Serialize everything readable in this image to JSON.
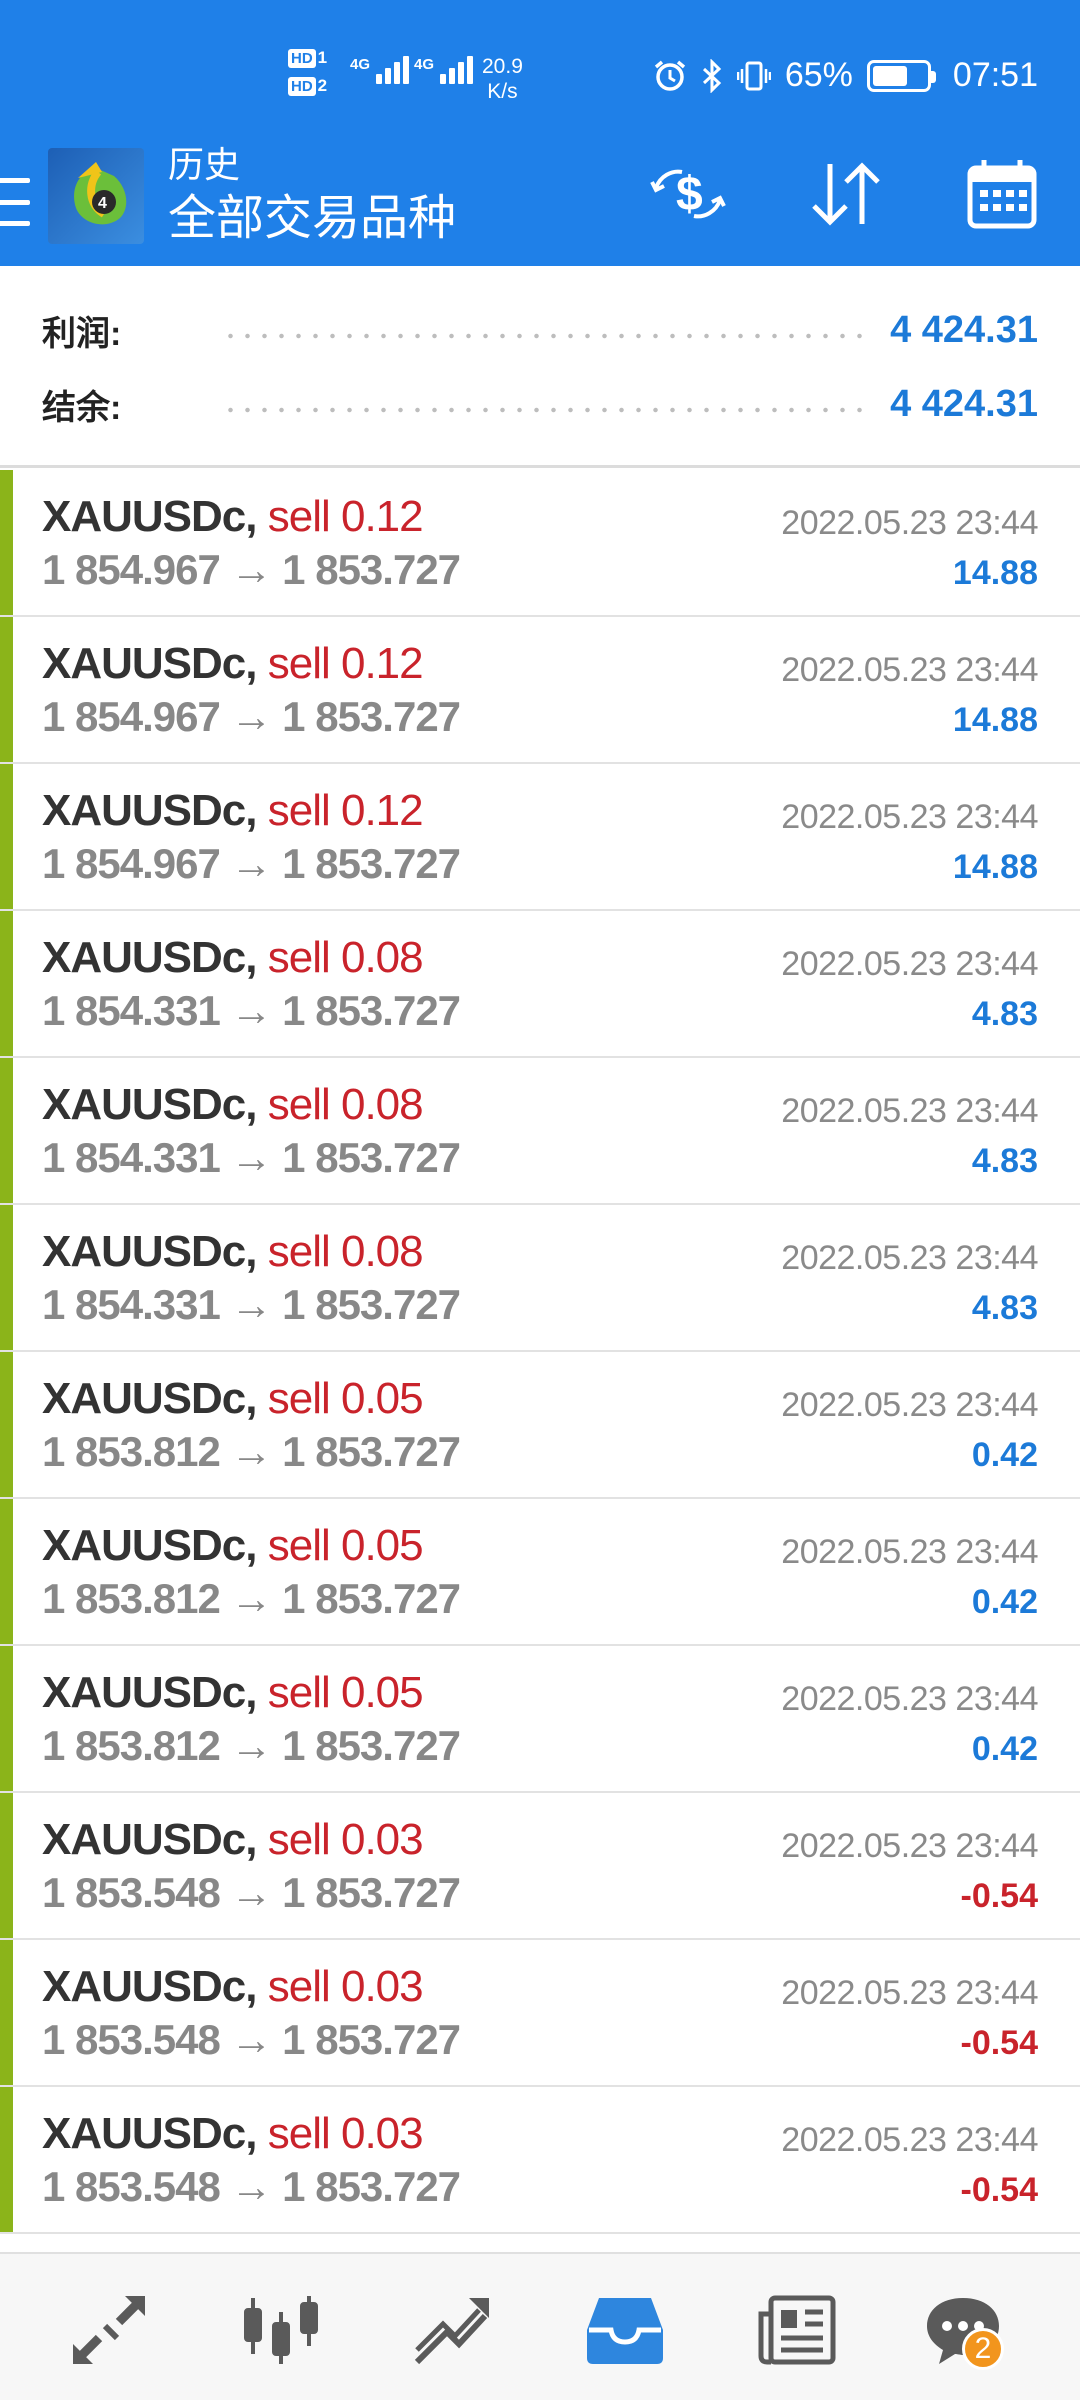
{
  "status_bar": {
    "hd1": "HD",
    "hd1_num": "1",
    "hd2": "HD",
    "hd2_num": "2",
    "sig1_label": "4G",
    "sig2_label": "4G",
    "speed_value": "20.9",
    "speed_unit": "K/s",
    "battery_percent": "65%",
    "battery_level": 0.65,
    "time": "07:51"
  },
  "toolbar": {
    "title_small": "历史",
    "title_big": "全部交易品种"
  },
  "summary": {
    "profit_label": "利润:",
    "profit_value": "4 424.31",
    "balance_label": "结余:",
    "balance_value": "4 424.31"
  },
  "deals": [
    {
      "symbol": "XAUUSDc,",
      "type": "sell 0.12",
      "prices": "1 854.967 → 1 853.727",
      "time": "2022.05.23 23:44",
      "profit": "14.88",
      "negative": false
    },
    {
      "symbol": "XAUUSDc,",
      "type": "sell 0.12",
      "prices": "1 854.967 → 1 853.727",
      "time": "2022.05.23 23:44",
      "profit": "14.88",
      "negative": false
    },
    {
      "symbol": "XAUUSDc,",
      "type": "sell 0.12",
      "prices": "1 854.967 → 1 853.727",
      "time": "2022.05.23 23:44",
      "profit": "14.88",
      "negative": false
    },
    {
      "symbol": "XAUUSDc,",
      "type": "sell 0.08",
      "prices": "1 854.331 → 1 853.727",
      "time": "2022.05.23 23:44",
      "profit": "4.83",
      "negative": false
    },
    {
      "symbol": "XAUUSDc,",
      "type": "sell 0.08",
      "prices": "1 854.331 → 1 853.727",
      "time": "2022.05.23 23:44",
      "profit": "4.83",
      "negative": false
    },
    {
      "symbol": "XAUUSDc,",
      "type": "sell 0.08",
      "prices": "1 854.331 → 1 853.727",
      "time": "2022.05.23 23:44",
      "profit": "4.83",
      "negative": false
    },
    {
      "symbol": "XAUUSDc,",
      "type": "sell 0.05",
      "prices": "1 853.812 → 1 853.727",
      "time": "2022.05.23 23:44",
      "profit": "0.42",
      "negative": false
    },
    {
      "symbol": "XAUUSDc,",
      "type": "sell 0.05",
      "prices": "1 853.812 → 1 853.727",
      "time": "2022.05.23 23:44",
      "profit": "0.42",
      "negative": false
    },
    {
      "symbol": "XAUUSDc,",
      "type": "sell 0.05",
      "prices": "1 853.812 → 1 853.727",
      "time": "2022.05.23 23:44",
      "profit": "0.42",
      "negative": false
    },
    {
      "symbol": "XAUUSDc,",
      "type": "sell 0.03",
      "prices": "1 853.548 → 1 853.727",
      "time": "2022.05.23 23:44",
      "profit": "-0.54",
      "negative": true
    },
    {
      "symbol": "XAUUSDc,",
      "type": "sell 0.03",
      "prices": "1 853.548 → 1 853.727",
      "time": "2022.05.23 23:44",
      "profit": "-0.54",
      "negative": true
    },
    {
      "symbol": "XAUUSDc,",
      "type": "sell 0.03",
      "prices": "1 853.548 → 1 853.727",
      "time": "2022.05.23 23:44",
      "profit": "-0.54",
      "negative": true
    }
  ],
  "bottom_nav": {
    "items": [
      "quotes-icon",
      "chart-candles-icon",
      "trade-icon",
      "history-inbox-icon",
      "news-icon",
      "chat-icon"
    ],
    "active": "history-inbox-icon",
    "chat_badge": "2"
  },
  "colors": {
    "header_bg": "#1f80e8",
    "profit_positive": "#1c7ad8",
    "profit_negative": "#c9232b",
    "sell_type": "#c9232b",
    "row_stripe": "#8bb41a",
    "badge": "#f2951d"
  }
}
